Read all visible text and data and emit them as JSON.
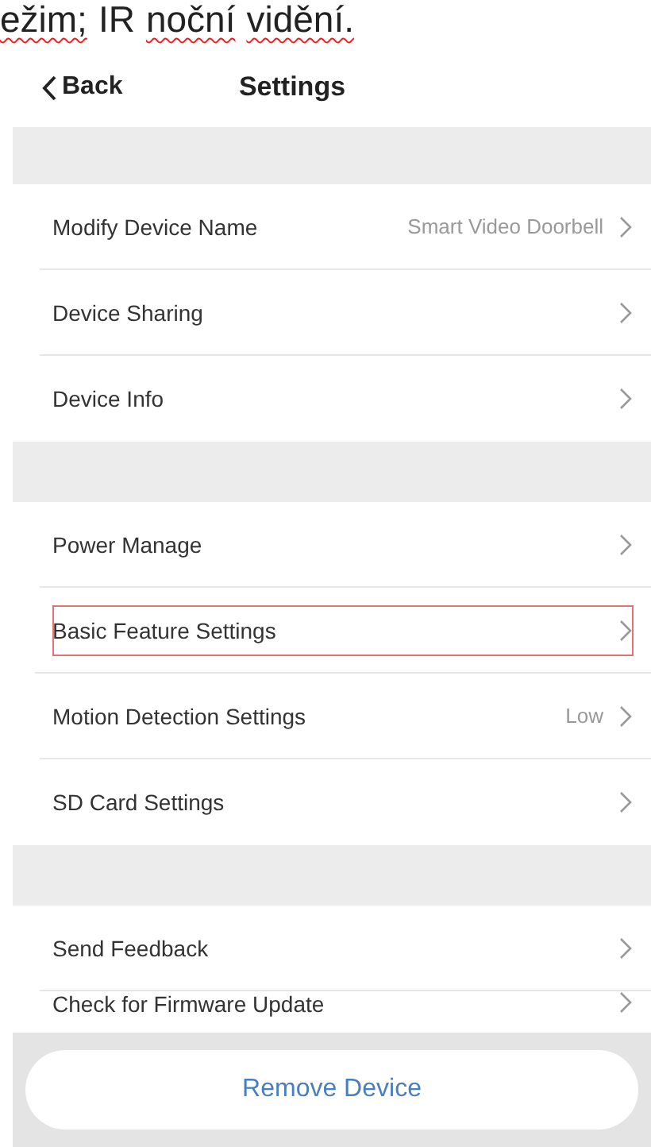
{
  "document_text": [
    {
      "text": "ežim;",
      "misspelled": true
    },
    {
      "text": "IR",
      "misspelled": false
    },
    {
      "text": "noční",
      "misspelled": true
    },
    {
      "text": "vidění.",
      "misspelled": true
    }
  ],
  "nav": {
    "back": "Back",
    "title": "Settings"
  },
  "sections": [
    {
      "items": [
        {
          "label": "Modify Device Name",
          "value": "Smart  Video Doorbell",
          "highlighted": false
        },
        {
          "label": "Device Sharing",
          "highlighted": false
        },
        {
          "label": "Device Info",
          "highlighted": false
        }
      ]
    },
    {
      "items": [
        {
          "label": "Power Manage",
          "highlighted": false
        },
        {
          "label": "Basic Feature Settings",
          "highlighted": true
        },
        {
          "label": "Motion Detection Settings",
          "value": "Low",
          "highlighted": false
        },
        {
          "label": "SD Card Settings",
          "highlighted": false
        }
      ]
    },
    {
      "items": [
        {
          "label": "Send Feedback",
          "highlighted": false
        },
        {
          "label": "Check for Firmware Update",
          "highlighted": false
        }
      ]
    }
  ],
  "remove_button": "Remove Device"
}
